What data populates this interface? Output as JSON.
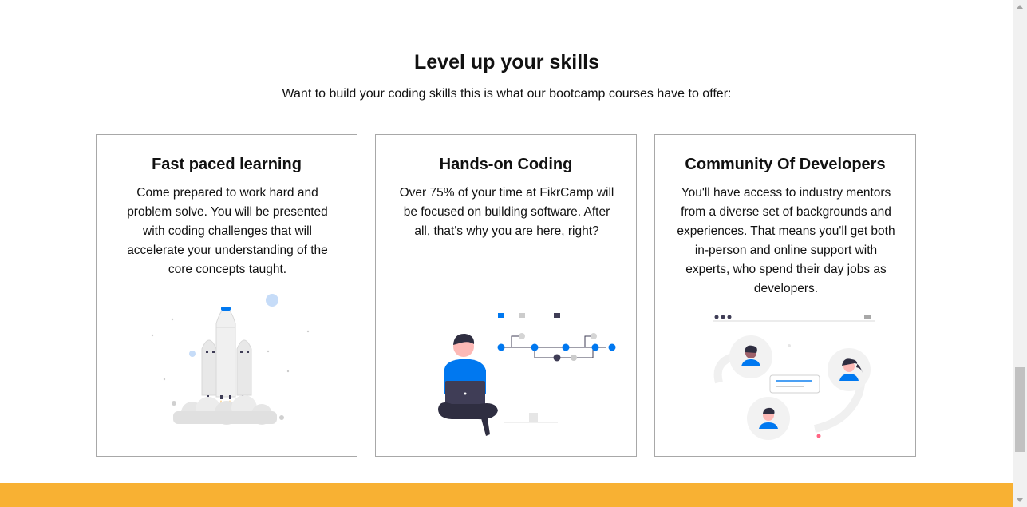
{
  "section": {
    "title": "Level up your skills",
    "subtitle": "Want to build your coding skills this is what our bootcamp courses have to offer:"
  },
  "cards": [
    {
      "title": "Fast paced learning",
      "text": "Come prepared to work hard and problem solve. You will be presented with coding challenges that will accelerate your understanding of the core concepts taught.",
      "illustration": "rocket-launch-illustration"
    },
    {
      "title": "Hands-on Coding",
      "text": "Over 75% of your time at FikrCamp will be focused on building software. After all, that's why you are here, right?",
      "illustration": "person-coding-laptop-illustration"
    },
    {
      "title": "Community Of Developers",
      "text": "You'll have access to industry mentors from a diverse set of backgrounds and experiences. That means you'll get both in-person and online support with experts, who spend their day jobs as developers.",
      "illustration": "developer-community-illustration"
    }
  ],
  "colors": {
    "accent": "#0078f0",
    "band": "#f8b133",
    "border": "#a8a8a8"
  }
}
